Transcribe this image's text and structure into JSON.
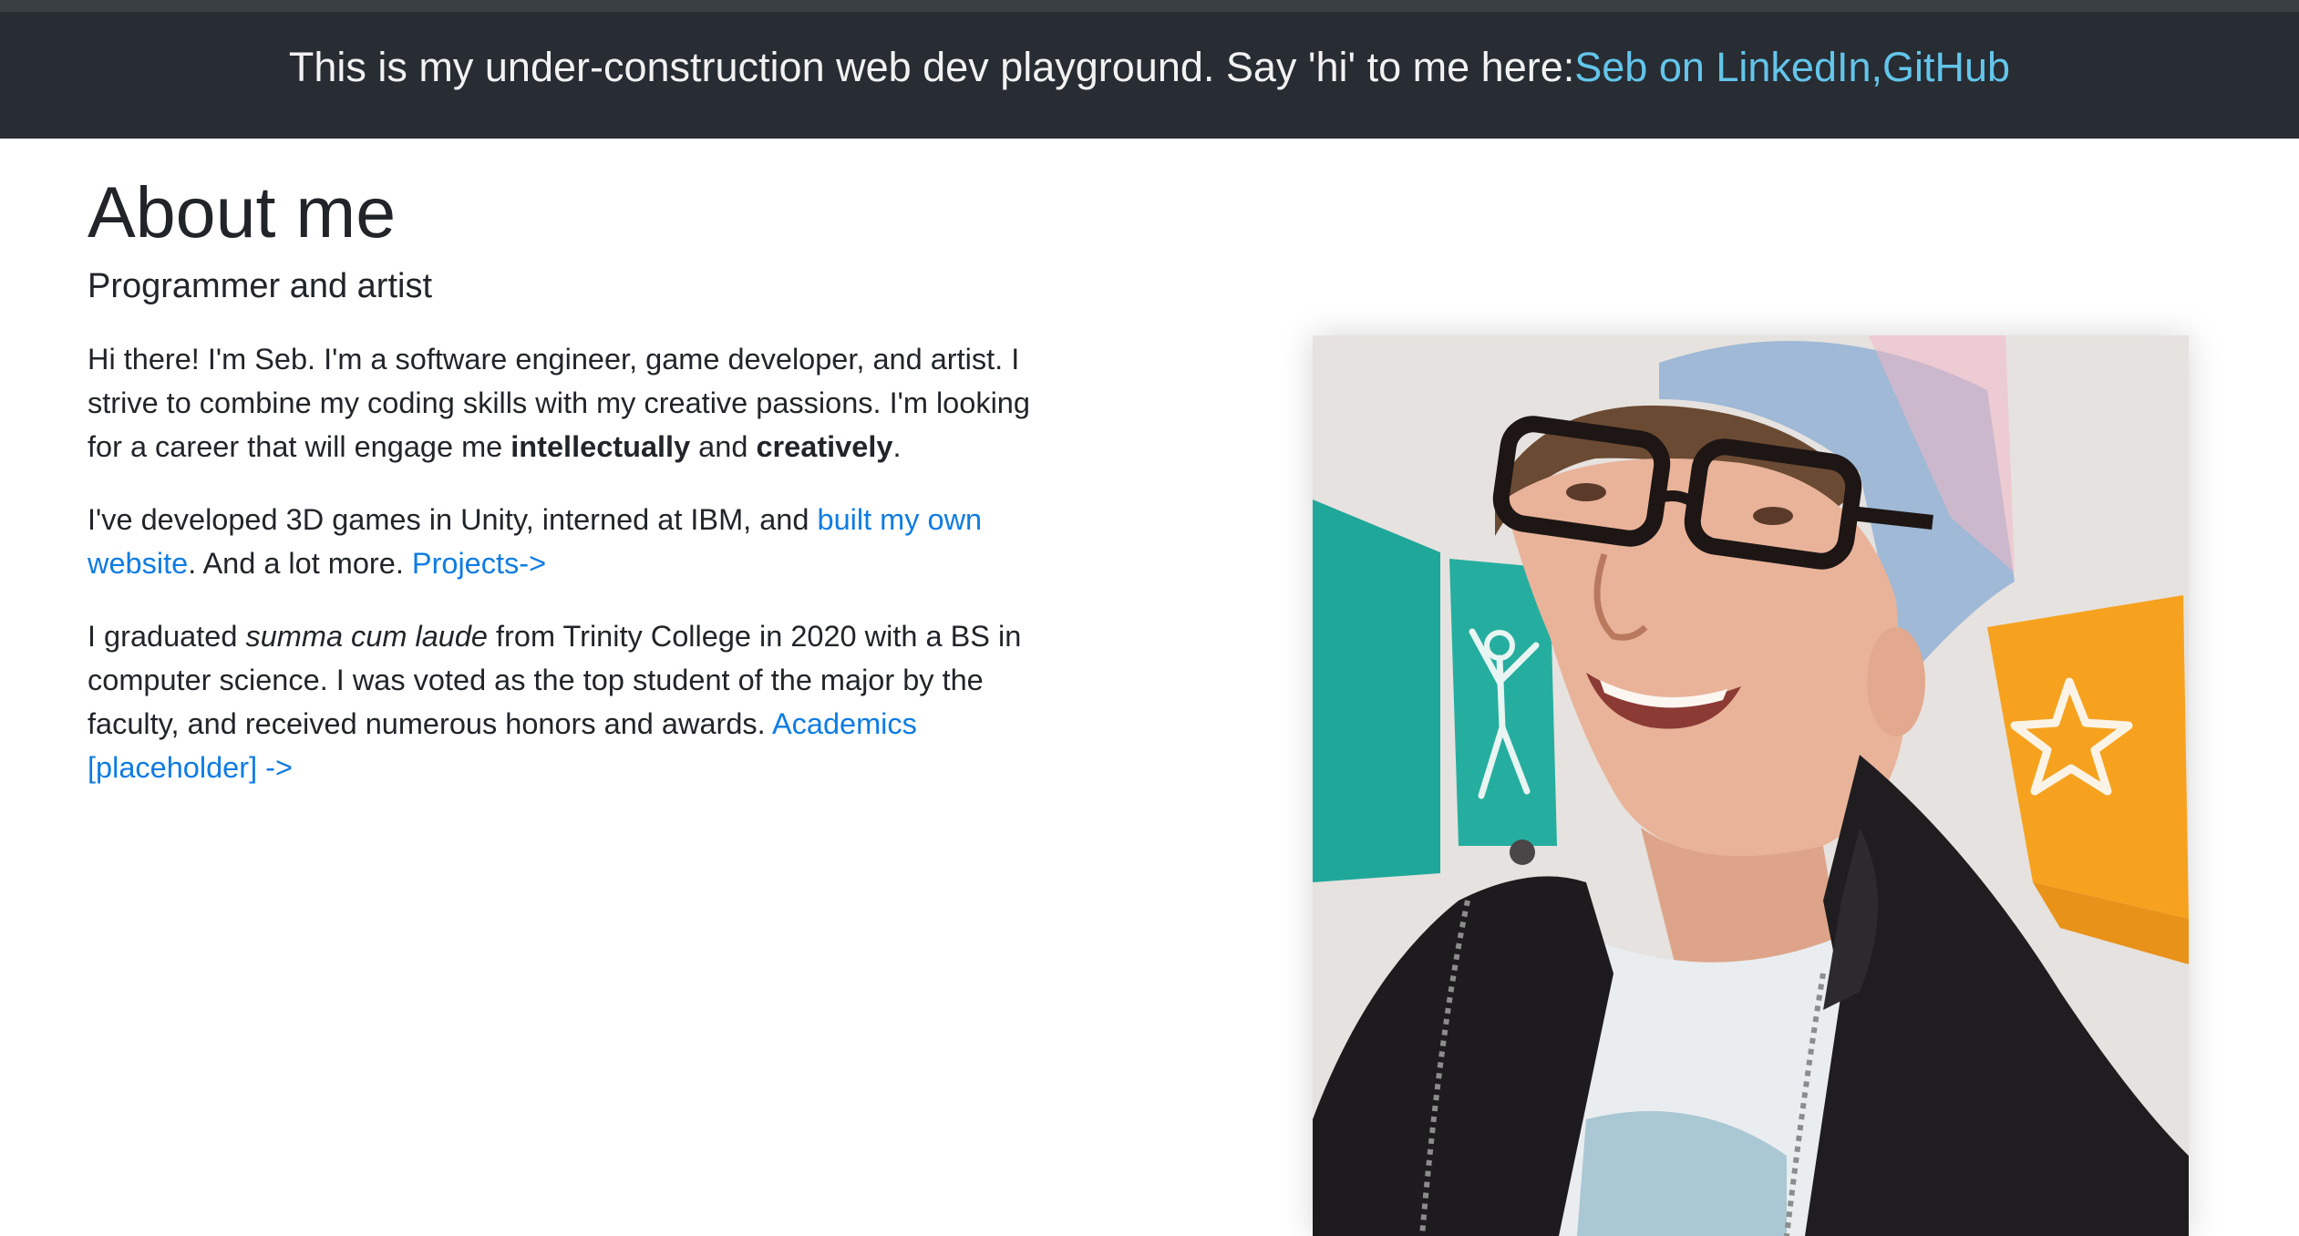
{
  "banner": {
    "text": "This is my under-construction web dev playground. Say 'hi' to me here:",
    "link_linkedin": "Seb on LinkedIn",
    "separator": ", ",
    "link_github": "GitHub"
  },
  "about": {
    "title": "About me",
    "subtitle": "Programmer and artist",
    "p1": {
      "text_a": "Hi there! I'm Seb. I'm a software engineer, game developer, and artist. I strive to combine my coding skills with my creative passions. I'm looking for a career that will engage me ",
      "bold_1": "intellectually",
      "text_b": " and ",
      "bold_2": "creatively",
      "text_c": "."
    },
    "p2": {
      "text_a": "I've developed 3D games in Unity, interned at IBM, and ",
      "link_website": "built my own website",
      "text_b": ". And a lot more. ",
      "link_projects": "Projects->"
    },
    "p3": {
      "text_a": "I graduated ",
      "italic": "summa cum laude",
      "text_b": " from Trinity College in 2020 with a BS in computer science. I was voted as the top student of the major by the faculty, and received numerous honors and awards. ",
      "link_academics": "Academics [placeholder] ->"
    }
  },
  "colors": {
    "banner_bg": "#282c33",
    "banner_link": "#63c5ea",
    "body_link": "#0e7ce3",
    "text": "#212529"
  }
}
